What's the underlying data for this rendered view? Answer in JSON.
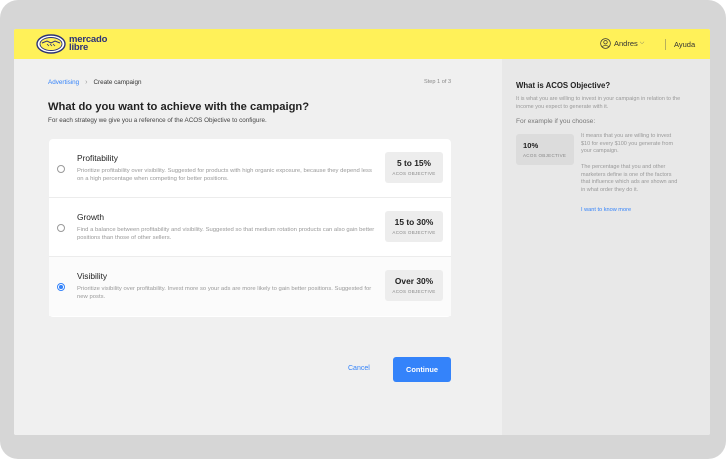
{
  "header": {
    "logo_line1": "mercado",
    "logo_line2": "libre",
    "user_name": "Andres",
    "help_label": "Ayuda"
  },
  "breadcrumb": {
    "link": "Advertising",
    "separator": "›",
    "current": "Create campaign"
  },
  "step": "Step 1 of 3",
  "title": "What do you want to achieve with the campaign?",
  "subtitle": "For each strategy we give you a reference of the ACOS Objective to configure.",
  "options": [
    {
      "name": "Profitability",
      "description": "Prioritize profitability over visibility. Suggested for products with high organic exposure, because they depend less on a high percentage when competing for better positions.",
      "value": "5 to 15%",
      "label": "ACOS OBJECTIVE",
      "selected": false
    },
    {
      "name": "Growth",
      "description": "Find a balance between profitability and visibility. Suggested so that medium rotation products can also gain better positions than those of other sellers.",
      "value": "15 to 30%",
      "label": "ACOS OBJECTIVE",
      "selected": false
    },
    {
      "name": "Visibility",
      "description": "Prioritize visibility over profitability. Invest more so your ads are more likely to gain better positions. Suggested for new posts.",
      "value": "Over 30%",
      "label": "ACOS OBJECTIVE",
      "selected": true
    }
  ],
  "actions": {
    "cancel": "Cancel",
    "continue": "Continue"
  },
  "side": {
    "title": "What is ACOS Objective?",
    "text": "It is what you are willing to invest in your campaign in relation to the income you expect to generate with it.",
    "example_label": "For example if you choose:",
    "example_value": "10%",
    "example_badge_label": "ACOS OBJECTIVE",
    "paragraph1": "It means that you are willing to invest $10 for every $100 you generate from your campaign.",
    "paragraph2": "The percentage that you and other marketers define is one of the factors that influence which ads are shown and in what order they do it.",
    "link": "I want to know more"
  },
  "colors": {
    "header_yellow": "#fff159",
    "accent_blue": "#3483fa",
    "brand_navy": "#2d3277"
  }
}
